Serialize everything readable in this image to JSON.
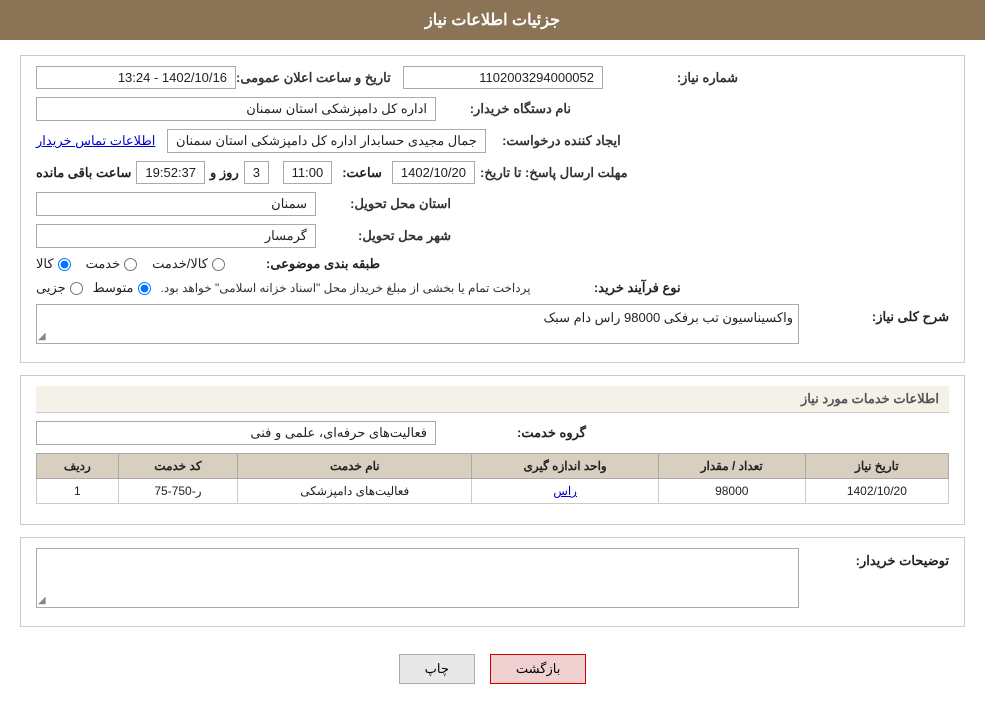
{
  "header": {
    "title": "جزئیات اطلاعات نیاز"
  },
  "form": {
    "need_number_label": "شماره نیاز:",
    "need_number_value": "1102003294000052",
    "announcement_datetime_label": "تاریخ و ساعت اعلان عمومی:",
    "announcement_datetime_value": "1402/10/16 - 13:24",
    "buyer_org_label": "نام دستگاه خریدار:",
    "buyer_org_value": "اداره کل دامپزشکی استان سمنان",
    "creator_label": "ایجاد کننده درخواست:",
    "creator_value": "جمال مجیدی حسابدار اداره کل دامپزشکی استان سمنان",
    "contact_link": "اطلاعات تماس خریدار",
    "deadline_label": "مهلت ارسال پاسخ: تا تاریخ:",
    "deadline_date": "1402/10/20",
    "deadline_time_label": "ساعت:",
    "deadline_time": "11:00",
    "remaining_label": "روز و",
    "remaining_days": "3",
    "remaining_time": "19:52:37",
    "remaining_suffix": "ساعت باقی مانده",
    "province_label": "استان محل تحویل:",
    "province_value": "سمنان",
    "city_label": "شهر محل تحویل:",
    "city_value": "گرمسار",
    "category_label": "طبقه بندی موضوعی:",
    "category_options": [
      {
        "label": "کالا",
        "selected": true
      },
      {
        "label": "خدمت",
        "selected": false
      },
      {
        "label": "کالا/خدمت",
        "selected": false
      }
    ],
    "process_label": "نوع فرآیند خرید:",
    "process_options": [
      {
        "label": "جزیی",
        "selected": false
      },
      {
        "label": "متوسط",
        "selected": true
      }
    ],
    "process_description": "پرداخت تمام یا بخشی از مبلغ خریداز محل \"اسناد خزانه اسلامی\" خواهد بود.",
    "narration_label": "شرح کلی نیاز:",
    "narration_value": "واکسیناسیون تب برفکی 98000 راس دام سبک"
  },
  "services_section": {
    "title": "اطلاعات خدمات مورد نیاز",
    "group_label": "گروه خدمت:",
    "group_value": "فعالیت‌های حرفه‌ای، علمی و فنی",
    "table": {
      "columns": [
        "ردیف",
        "کد خدمت",
        "نام خدمت",
        "واحد اندازه گیری",
        "تعداد / مقدار",
        "تاریخ نیاز"
      ],
      "rows": [
        {
          "row_num": "1",
          "service_code": "ر-750-75",
          "service_name": "فعالیت‌های دامپزشکی",
          "unit": "راس",
          "quantity": "98000",
          "date": "1402/10/20"
        }
      ]
    }
  },
  "buyer_description": {
    "label": "توضیحات خریدار:"
  },
  "buttons": {
    "print_label": "چاپ",
    "back_label": "بازگشت"
  }
}
